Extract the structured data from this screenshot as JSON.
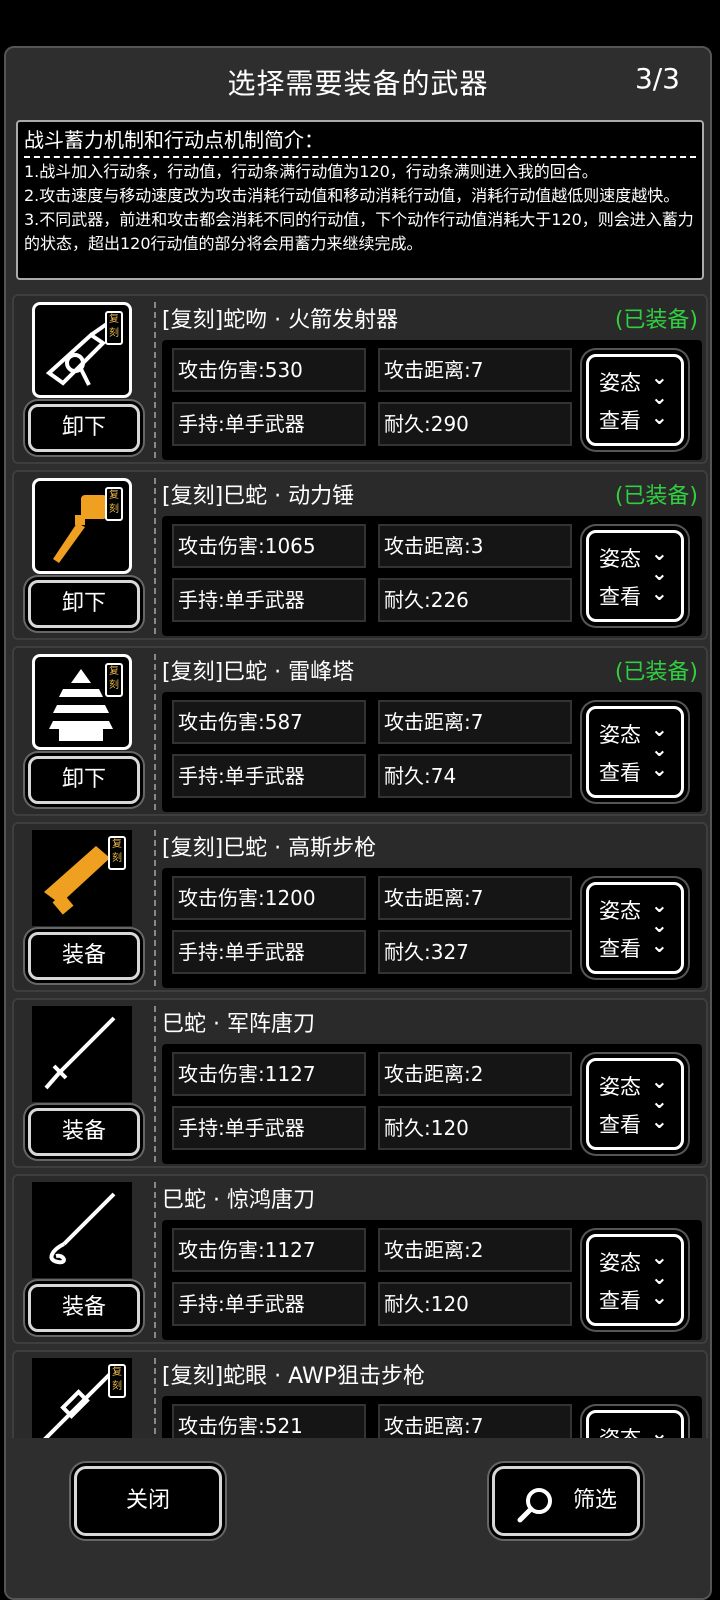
{
  "header": {
    "title": "选择需要装备的武器",
    "page": "3/3"
  },
  "info": {
    "title": "战斗蓄力机制和行动点机制简介：",
    "lines": [
      "1.战斗加入行动条，行动值，行动条满行动值为120，行动条满则进入我的回合。",
      "2.攻击速度与移动速度改为攻击消耗行动值和移动消耗行动值，消耗行动值越低则速度越快。",
      "3.不同武器，前进和攻击都会消耗不同的行动值，下个动作行动值消耗大于120，则会进入蓄力的状态，超出120行动值的部分将会用蓄力来继续完成。"
    ]
  },
  "badge_text": "复刻",
  "stance_labels": {
    "line1": "姿态",
    "line2": "查看",
    "chevrons": "❯❯❯"
  },
  "weapons": [
    {
      "name": "[复刻]蛇吻 · 火箭发射器",
      "status": "(已装备)",
      "attack": "攻击伤害:530",
      "range": "攻击距离:7",
      "hold": "手持:单手武器",
      "durability": "耐久:290",
      "action": "卸下",
      "icon": "rocket-launcher-icon",
      "color": "#ffffff"
    },
    {
      "name": "[复刻]巳蛇 · 动力锤",
      "status": "(已装备)",
      "attack": "攻击伤害:1065",
      "range": "攻击距离:3",
      "hold": "手持:单手武器",
      "durability": "耐久:226",
      "action": "卸下",
      "icon": "power-hammer-icon",
      "color": "#f0a020"
    },
    {
      "name": "[复刻]巳蛇 · 雷峰塔",
      "status": "(已装备)",
      "attack": "攻击伤害:587",
      "range": "攻击距离:7",
      "hold": "手持:单手武器",
      "durability": "耐久:74",
      "action": "卸下",
      "icon": "pagoda-icon",
      "color": "#ffffff"
    },
    {
      "name": "[复刻]巳蛇 · 高斯步枪",
      "status": "",
      "attack": "攻击伤害:1200",
      "range": "攻击距离:7",
      "hold": "手持:单手武器",
      "durability": "耐久:327",
      "action": "装备",
      "icon": "gauss-rifle-icon",
      "color": "#f0a020"
    },
    {
      "name": "巳蛇 · 军阵唐刀",
      "status": "",
      "attack": "攻击伤害:1127",
      "range": "攻击距离:2",
      "hold": "手持:单手武器",
      "durability": "耐久:120",
      "action": "装备",
      "icon": "tang-sword-icon",
      "color": "#ffffff"
    },
    {
      "name": "巳蛇 · 惊鸿唐刀",
      "status": "",
      "attack": "攻击伤害:1127",
      "range": "攻击距离:2",
      "hold": "手持:单手武器",
      "durability": "耐久:120",
      "action": "装备",
      "icon": "tang-sword-icon",
      "color": "#ffffff"
    },
    {
      "name": "[复刻]蛇眼 · AWP狙击步枪",
      "status": "",
      "attack": "攻击伤害:521",
      "range": "攻击距离:7",
      "hold": "",
      "durability": "",
      "action": "",
      "icon": "sniper-rifle-icon",
      "color": "#ffffff"
    }
  ],
  "footer": {
    "close_label": "关闭",
    "filter_label": "筛选"
  },
  "colors": {
    "equipped": "#2fcf3f",
    "badge": "#e8b84a"
  }
}
